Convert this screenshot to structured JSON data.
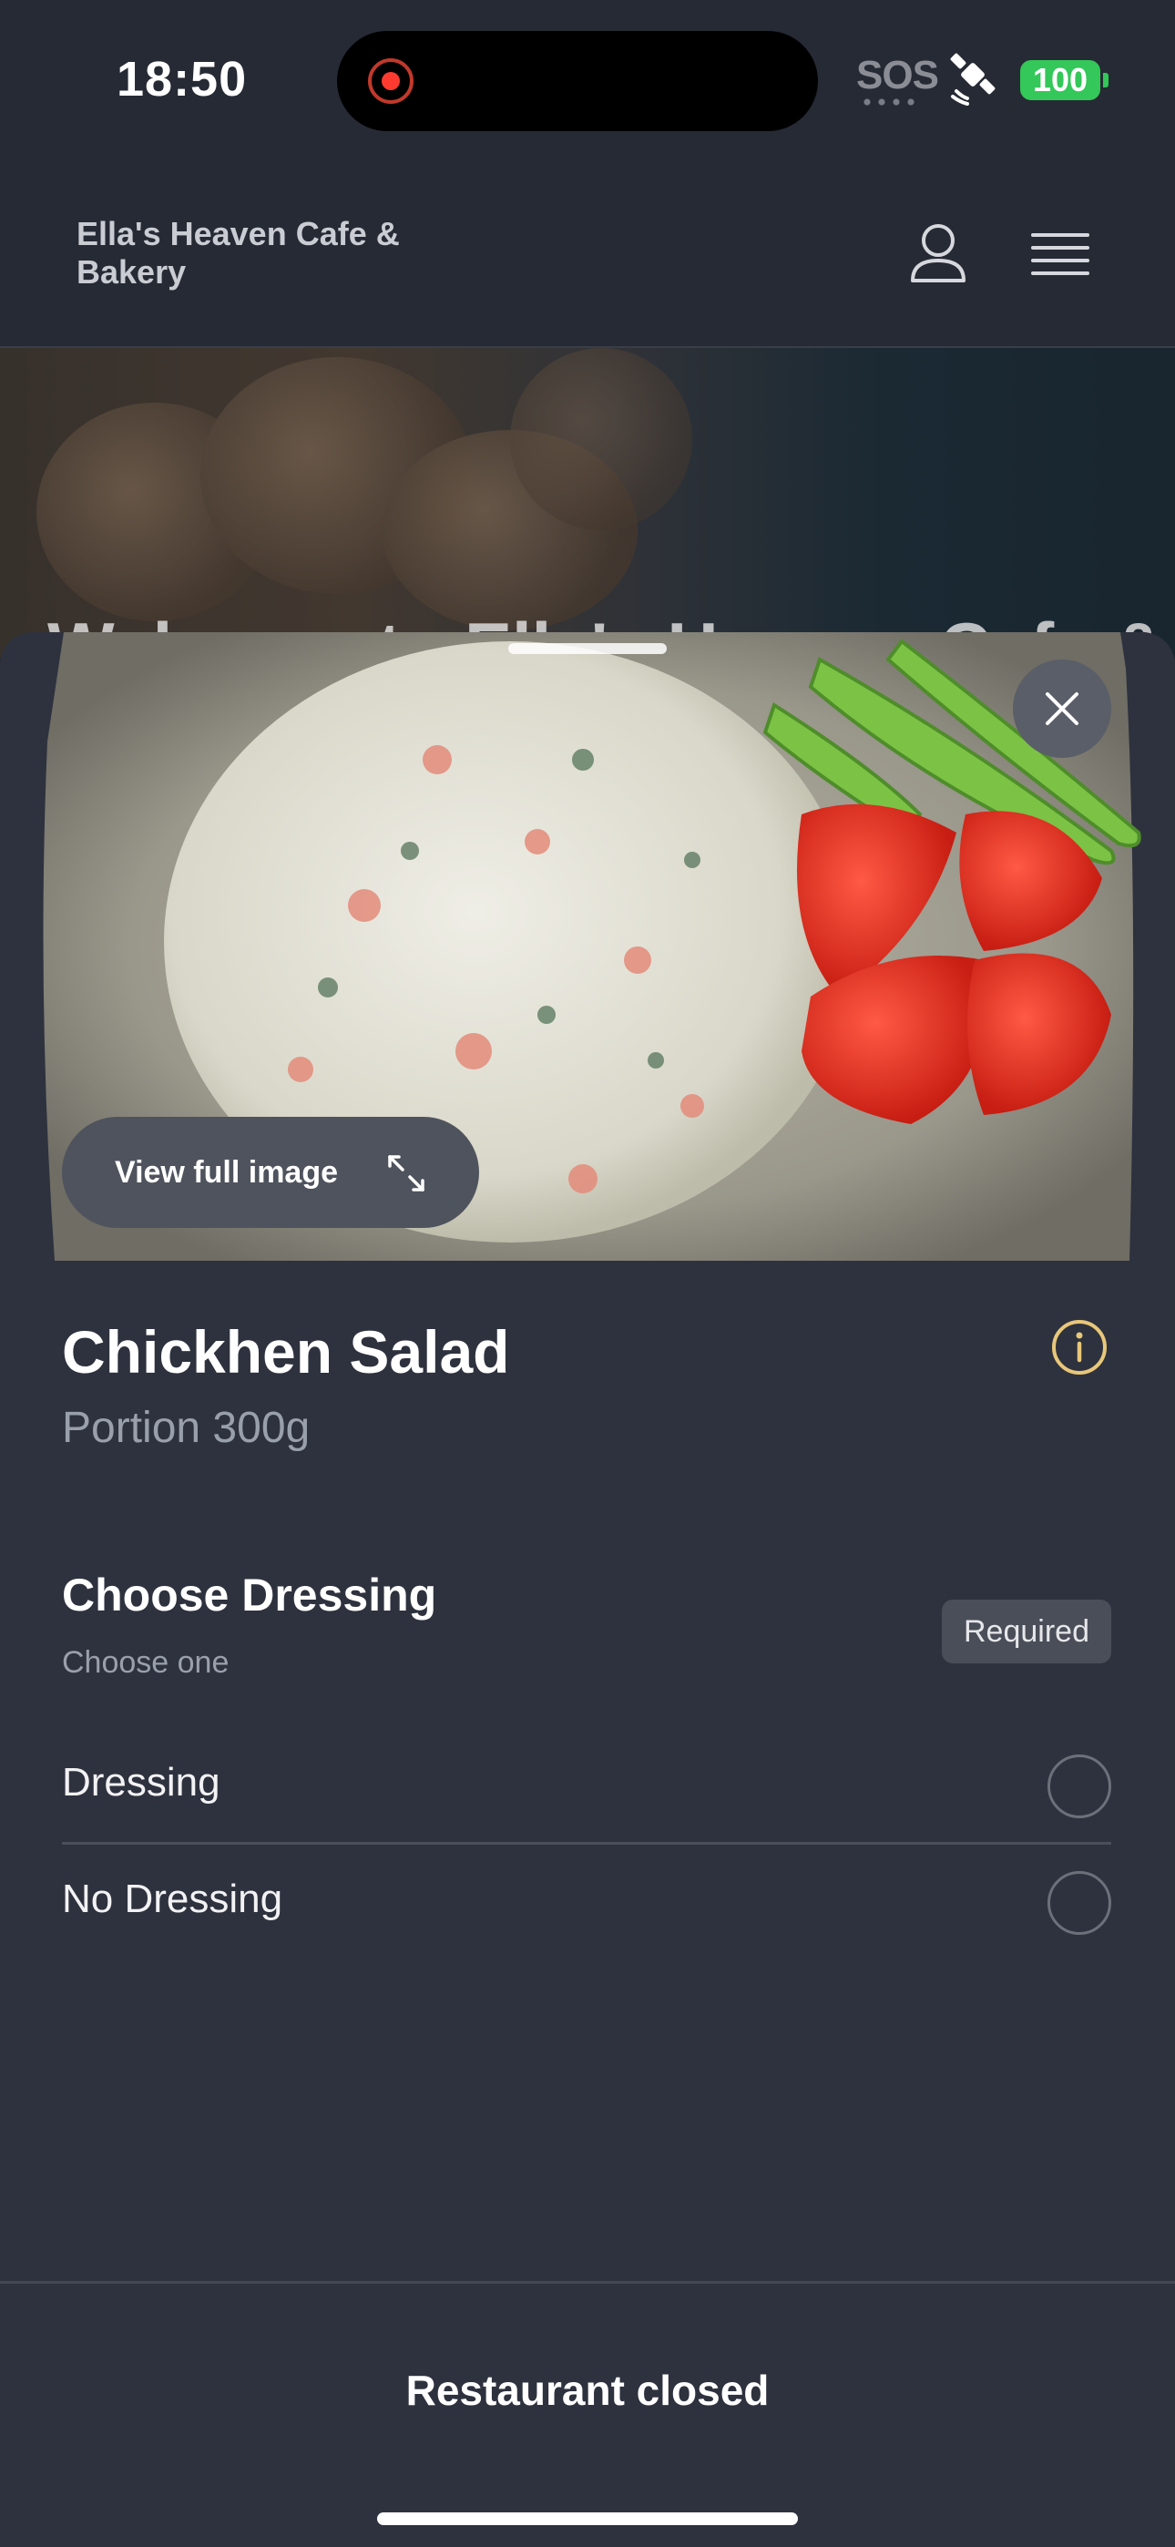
{
  "status_bar": {
    "time": "18:50",
    "sos": "SOS",
    "battery": "100",
    "icons": [
      "record-indicator-icon",
      "satellite-icon",
      "battery-icon"
    ]
  },
  "header": {
    "brand": "Ella's Heaven Cafe & Bakery",
    "icons": [
      "user-icon",
      "menu-icon"
    ]
  },
  "hero": {
    "headline_partial": "Welcome to Ella's Heaven Cafe &"
  },
  "product": {
    "view_full_image_label": "View full image",
    "name": "Chickhen Salad",
    "portion": "Portion 300g",
    "icons": [
      "close-icon",
      "expand-icon",
      "info-icon"
    ]
  },
  "dressing": {
    "title": "Choose Dressing",
    "subtitle": "Choose one",
    "badge": "Required",
    "options": [
      {
        "label": "Dressing",
        "selected": false
      },
      {
        "label": "No Dressing",
        "selected": false
      }
    ]
  },
  "footer": {
    "label": "Restaurant closed"
  },
  "colors": {
    "background": "#242731",
    "sheet": "#2e323e",
    "accent_info": "#e8c77a",
    "battery": "#34c759",
    "record": "#ff3b30"
  }
}
